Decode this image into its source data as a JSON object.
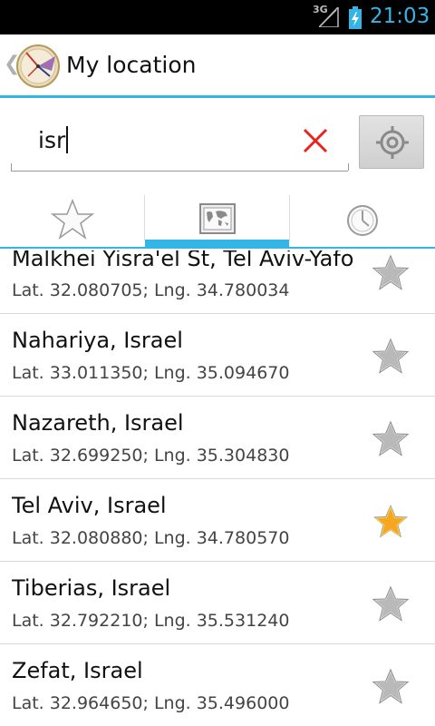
{
  "status_bar": {
    "network": "3G",
    "time": "21:03"
  },
  "action_bar": {
    "title": "My location",
    "accent_color": "#33b5e5"
  },
  "search": {
    "value": "isr"
  },
  "tabs": [
    {
      "icon": "star-icon",
      "selected": false
    },
    {
      "icon": "map-icon",
      "selected": true
    },
    {
      "icon": "clock-icon",
      "selected": false
    }
  ],
  "results": [
    {
      "name": "Malkhei Yisra'el St, Tel Aviv-Yafo",
      "coords": "Lat. 32.080705; Lng. 34.780034",
      "favorite": false
    },
    {
      "name": "Nahariya, Israel",
      "coords": "Lat. 33.011350; Lng. 35.094670",
      "favorite": false
    },
    {
      "name": "Nazareth, Israel",
      "coords": "Lat. 32.699250; Lng. 35.304830",
      "favorite": false
    },
    {
      "name": "Tel Aviv, Israel",
      "coords": "Lat. 32.080880; Lng. 34.780570",
      "favorite": true
    },
    {
      "name": "Tiberias, Israel",
      "coords": "Lat. 32.792210; Lng. 35.531240",
      "favorite": false
    },
    {
      "name": "Zefat, Israel",
      "coords": "Lat. 32.964650; Lng. 35.496000",
      "favorite": false
    }
  ]
}
